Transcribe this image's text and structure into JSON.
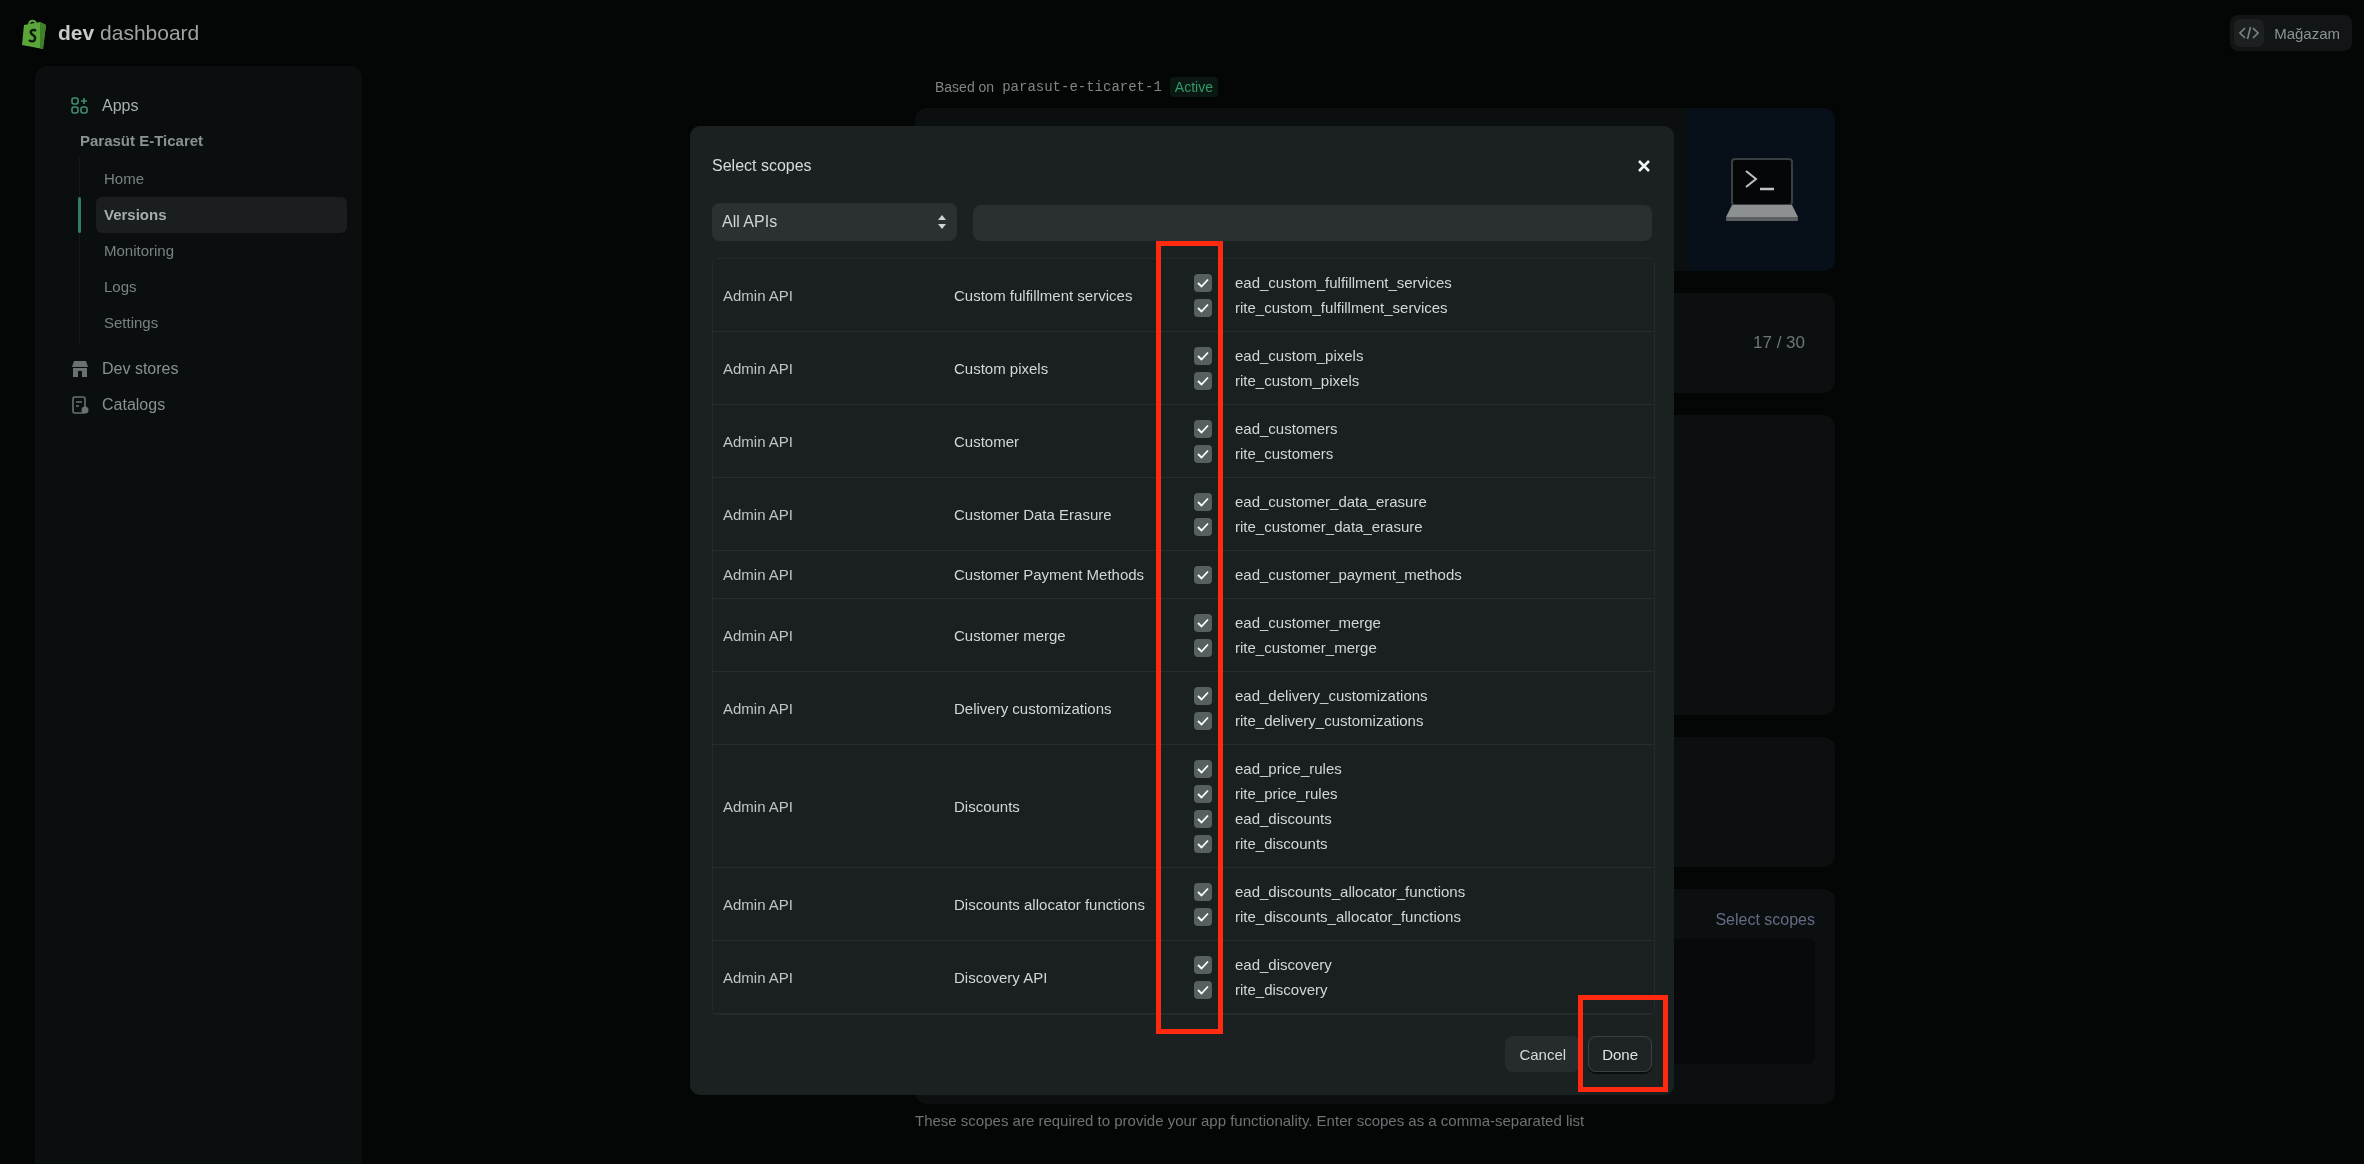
{
  "header": {
    "brand": "**dev** dashboard",
    "store_button": "Mağazam"
  },
  "sidebar": {
    "items": [
      {
        "label": "Apps",
        "children": [
          {
            "label": "Parasüt E-Ticaret",
            "children": [
              {
                "label": "Home",
                "selected": false
              },
              {
                "label": "Versions",
                "selected": true
              },
              {
                "label": "Monitoring",
                "selected": false
              },
              {
                "label": "Logs",
                "selected": false
              },
              {
                "label": "Settings",
                "selected": false
              }
            ]
          }
        ]
      },
      {
        "label": "Dev stores"
      },
      {
        "label": "Catalogs"
      }
    ]
  },
  "page": {
    "based_on": "Based on",
    "version": "parasut-e-ticaret-1",
    "status": "Active",
    "scope_count": "17 / 30",
    "select_scopes_link": "Select scopes",
    "help_text": "These scopes are required to provide your app functionality. Enter scopes as a comma-separated list"
  },
  "modal": {
    "title": "Select scopes",
    "api_filter": "All APIs",
    "rows": [
      {
        "api": "Admin API",
        "category": "Custom fulfillment services",
        "scopes": [
          {
            "name": "ead_custom_fulfillment_services",
            "checked": true
          },
          {
            "name": "rite_custom_fulfillment_services",
            "checked": true
          }
        ]
      },
      {
        "api": "Admin API",
        "category": "Custom pixels",
        "scopes": [
          {
            "name": "ead_custom_pixels",
            "checked": true
          },
          {
            "name": "rite_custom_pixels",
            "checked": true
          }
        ]
      },
      {
        "api": "Admin API",
        "category": "Customer",
        "scopes": [
          {
            "name": "ead_customers",
            "checked": true
          },
          {
            "name": "rite_customers",
            "checked": true
          }
        ]
      },
      {
        "api": "Admin API",
        "category": "Customer Data Erasure",
        "scopes": [
          {
            "name": "ead_customer_data_erasure",
            "checked": true
          },
          {
            "name": "rite_customer_data_erasure",
            "checked": true
          }
        ]
      },
      {
        "api": "Admin API",
        "category": "Customer Payment Methods",
        "scopes": [
          {
            "name": "ead_customer_payment_methods",
            "checked": true
          }
        ]
      },
      {
        "api": "Admin API",
        "category": "Customer merge",
        "scopes": [
          {
            "name": "ead_customer_merge",
            "checked": true
          },
          {
            "name": "rite_customer_merge",
            "checked": true
          }
        ]
      },
      {
        "api": "Admin API",
        "category": "Delivery customizations",
        "scopes": [
          {
            "name": "ead_delivery_customizations",
            "checked": true
          },
          {
            "name": "rite_delivery_customizations",
            "checked": true
          }
        ]
      },
      {
        "api": "Admin API",
        "category": "Discounts",
        "scopes": [
          {
            "name": "ead_price_rules",
            "checked": true
          },
          {
            "name": "rite_price_rules",
            "checked": true
          },
          {
            "name": "ead_discounts",
            "checked": true
          },
          {
            "name": "rite_discounts",
            "checked": true
          }
        ]
      },
      {
        "api": "Admin API",
        "category": "Discounts allocator functions",
        "scopes": [
          {
            "name": "ead_discounts_allocator_functions",
            "checked": true
          },
          {
            "name": "rite_discounts_allocator_functions",
            "checked": true
          }
        ]
      },
      {
        "api": "Admin API",
        "category": "Discovery API",
        "scopes": [
          {
            "name": "ead_discovery",
            "checked": true
          },
          {
            "name": "rite_discovery",
            "checked": true
          }
        ]
      }
    ],
    "buttons": [
      {
        "label": "Cancel",
        "kind": "secondary"
      },
      {
        "label": "Done",
        "kind": "primary"
      }
    ]
  }
}
